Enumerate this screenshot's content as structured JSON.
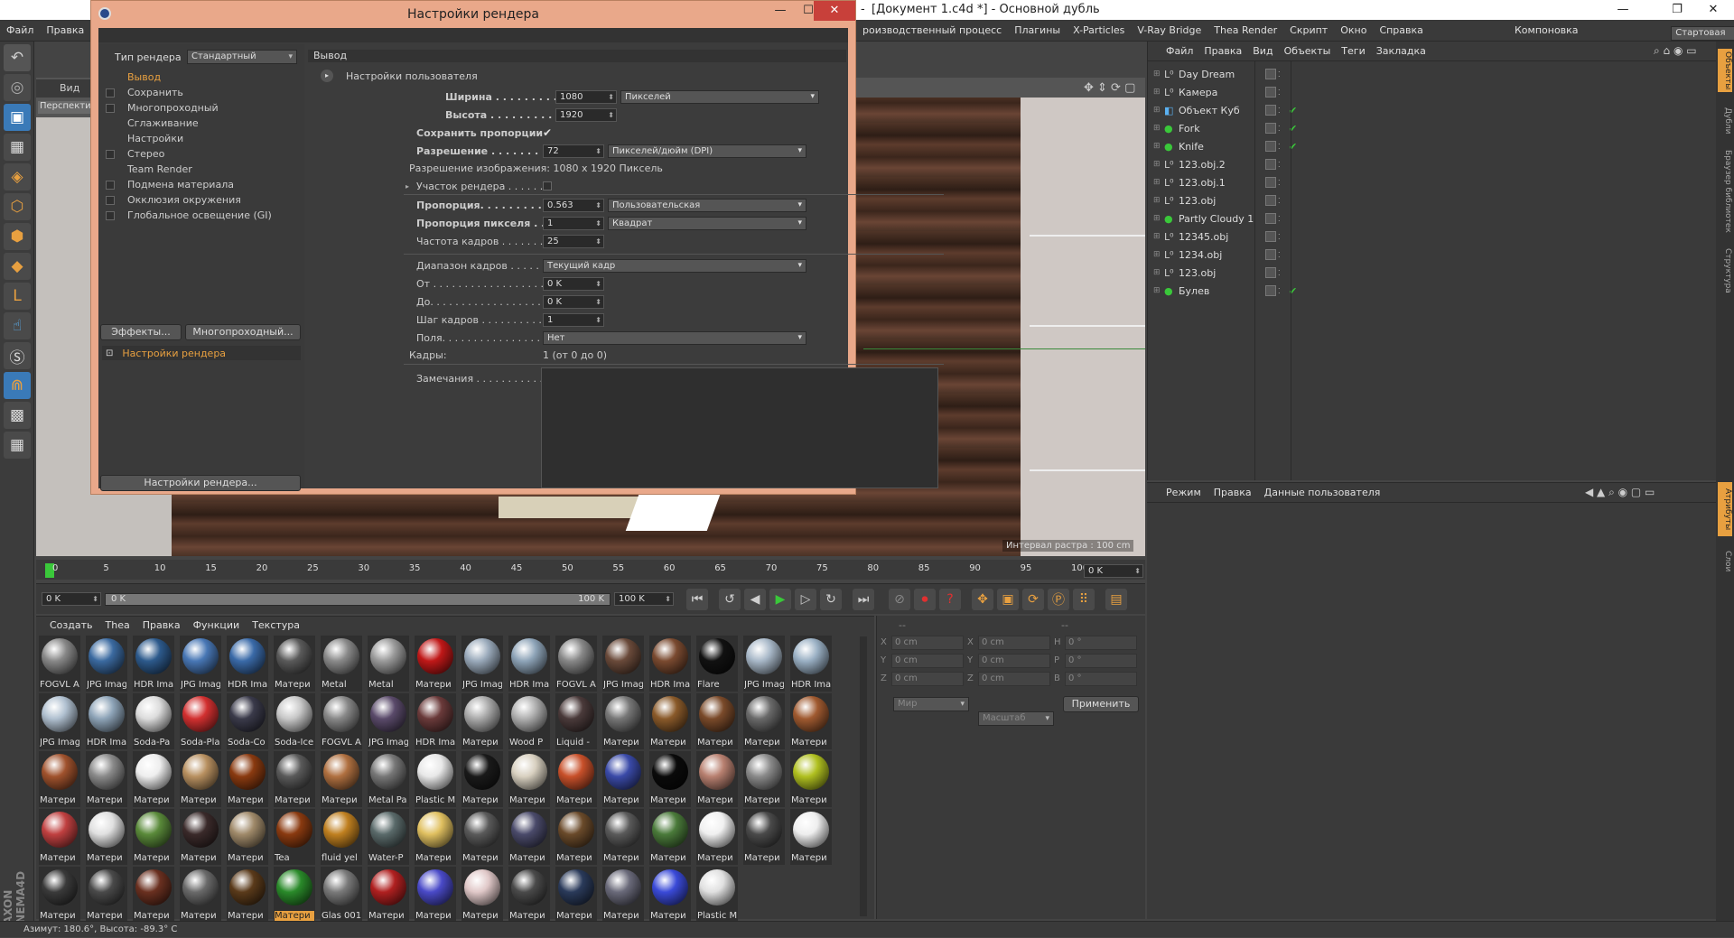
{
  "app": {
    "title": "[Документ 1.c4d *] - Основной дубль",
    "title_prefix": "-"
  },
  "menubar": {
    "items": [
      "Файл",
      "Правка"
    ],
    "right_items": [
      "роизводственный процесс",
      "Плагины",
      "X-Particles",
      "V-Ray Bridge",
      "Thea Render",
      "Скрипт",
      "Окно",
      "Справка"
    ],
    "layout_label": "Компоновка",
    "layout_value": "Стартовая"
  },
  "viewport": {
    "view_label": "Вид",
    "perspective": "Перспекти",
    "raster": "Интервал растра : 100 cm"
  },
  "timeline": {
    "ticks": [
      "0",
      "5",
      "10",
      "15",
      "20",
      "25",
      "30",
      "35",
      "40",
      "45",
      "50",
      "55",
      "60",
      "65",
      "70",
      "75",
      "80",
      "85",
      "90",
      "95",
      "100"
    ],
    "current_frame": "0 K",
    "start": "0 K",
    "range_start": "0 K",
    "range_end": "100 K",
    "end": "100 K"
  },
  "materials": {
    "menu": [
      "Создать",
      "Thea",
      "Правка",
      "Функции",
      "Текстура"
    ],
    "items": [
      {
        "label": "FOGVL A",
        "color": "#888"
      },
      {
        "label": "JPG Imag",
        "color": "#3b6aa0"
      },
      {
        "label": "HDR Ima",
        "color": "#2d5a8c"
      },
      {
        "label": "JPG Imag",
        "color": "#4877b5"
      },
      {
        "label": "HDR Ima",
        "color": "#3a6aa8"
      },
      {
        "label": "Матери",
        "color": "#5a5a5a"
      },
      {
        "label": "Metal",
        "color": "#8a8a8a"
      },
      {
        "label": "Metal",
        "color": "#9a9a9a"
      },
      {
        "label": "Матери",
        "color": "#c01818"
      },
      {
        "label": "JPG Imag",
        "color": "#9aaabb"
      },
      {
        "label": "HDR Ima",
        "color": "#8ea4b8"
      },
      {
        "label": "FOGVL A",
        "color": "#888"
      },
      {
        "label": "JPG Imag",
        "color": "#6a4a3a"
      },
      {
        "label": "HDR Ima",
        "color": "#7a4a30"
      },
      {
        "label": "Flare",
        "color": "#111"
      },
      {
        "label": "JPG Imag",
        "color": "#a8b8c8"
      },
      {
        "label": "HDR Ima",
        "color": "#9ab0c4"
      },
      {
        "label": "JPG Imag",
        "color": "#b0c0d0"
      },
      {
        "label": "HDR Ima",
        "color": "#8ea4b8"
      },
      {
        "label": "Soda-Pa",
        "color": "#dcdcdc"
      },
      {
        "label": "Soda-Pla",
        "color": "#d23030"
      },
      {
        "label": "Soda-Co",
        "color": "#3a3a4a"
      },
      {
        "label": "Soda-Ice",
        "color": "#c8c8c8"
      },
      {
        "label": "FOGVL A",
        "color": "#888"
      },
      {
        "label": "JPG Imag",
        "color": "#5a4a6a"
      },
      {
        "label": "HDR Ima",
        "color": "#6a3a3a"
      },
      {
        "label": "Матери",
        "color": "#aaaaaa"
      },
      {
        "label": "Wood P",
        "color": "#b0b0b0"
      },
      {
        "label": "Liquid -",
        "color": "#4a3a3a"
      },
      {
        "label": "Матери",
        "color": "#777777"
      },
      {
        "label": "Матери",
        "color": "#8a5a2a"
      },
      {
        "label": "Матери",
        "color": "#7a4a2a"
      },
      {
        "label": "Матери",
        "color": "#6a6a6a"
      },
      {
        "label": "Матери",
        "color": "#a05a30"
      },
      {
        "label": "Матери",
        "color": "#a0522d"
      },
      {
        "label": "Матери",
        "color": "#8a8a8a"
      },
      {
        "label": "Матери",
        "color": "#eeeeee"
      },
      {
        "label": "Матери",
        "color": "#b89060"
      },
      {
        "label": "Матери",
        "color": "#8a3a10"
      },
      {
        "label": "Матери",
        "color": "#5a5a5a"
      },
      {
        "label": "Матери",
        "color": "#b07040"
      },
      {
        "label": "Metal Pa",
        "color": "#777777"
      },
      {
        "label": "Plastic M",
        "color": "#e8e8e8"
      },
      {
        "label": "Матери",
        "color": "#1a1a1a"
      },
      {
        "label": "Матери",
        "color": "#d8d0c0"
      },
      {
        "label": "Матери",
        "color": "#c8502a"
      },
      {
        "label": "Матери",
        "color": "#3a4aa8"
      },
      {
        "label": "Матери",
        "color": "#0a0a0a"
      },
      {
        "label": "Матери",
        "color": "#b88070"
      },
      {
        "label": "Матери",
        "color": "#8a8a8a"
      },
      {
        "label": "Матери",
        "color": "#b0c020"
      },
      {
        "label": "Матери",
        "color": "#c04040"
      },
      {
        "label": "Матери",
        "color": "#e0e0e0"
      },
      {
        "label": "Матери",
        "color": "#5a8a3a"
      },
      {
        "label": "Матери",
        "color": "#3a2a2a"
      },
      {
        "label": "Матери",
        "color": "#a08a6a"
      },
      {
        "label": "Tea",
        "color": "#8a3a10"
      },
      {
        "label": "fluid yel",
        "color": "#c08020"
      },
      {
        "label": "Water-P",
        "color": "#5a6a6a"
      },
      {
        "label": "Матери",
        "color": "#e0c060"
      },
      {
        "label": "Матери",
        "color": "#5a5a5a"
      },
      {
        "label": "Матери",
        "color": "#4a4a6a"
      },
      {
        "label": "Матери",
        "color": "#6a4a2a"
      },
      {
        "label": "Матери",
        "color": "#5a5a5a"
      },
      {
        "label": "Матери",
        "color": "#4a7a3a"
      },
      {
        "label": "Матери",
        "color": "#f0f0f0"
      },
      {
        "label": "Матери",
        "color": "#4a4a4a"
      },
      {
        "label": "Матери",
        "color": "#eeeeee"
      },
      {
        "label": "Матери",
        "color": "#3a3a3a"
      },
      {
        "label": "Матери",
        "color": "#4a4a4a"
      },
      {
        "label": "Матери",
        "color": "#6a3020"
      },
      {
        "label": "Матери",
        "color": "#6a6a6a"
      },
      {
        "label": "Матери",
        "color": "#5a3a1a"
      },
      {
        "label": "Матери",
        "color": "#2a8a2a"
      },
      {
        "label": "Glas 001",
        "color": "#7a7a7a"
      },
      {
        "label": "Матери",
        "color": "#b02020"
      },
      {
        "label": "Матери",
        "color": "#4a4ac8"
      },
      {
        "label": "Матери",
        "color": "#e0c8c8"
      },
      {
        "label": "Матери",
        "color": "#4a4a4a"
      },
      {
        "label": "Матери",
        "color": "#2a3a5a"
      },
      {
        "label": "Матери",
        "color": "#6a6a7a"
      },
      {
        "label": "Матери",
        "color": "#3a4ad8"
      },
      {
        "label": "Plastic M",
        "color": "#e0e0e0"
      }
    ],
    "selected_index": 73
  },
  "coords": {
    "rows": [
      {
        "a": "X",
        "av": "0 cm",
        "b": "X",
        "bv": "0 cm",
        "c": "H",
        "cv": "0 °"
      },
      {
        "a": "Y",
        "av": "0 cm",
        "b": "Y",
        "bv": "0 cm",
        "c": "P",
        "cv": "0 °"
      },
      {
        "a": "Z",
        "av": "0 cm",
        "b": "Z",
        "bv": "0 cm",
        "c": "B",
        "cv": "0 °"
      }
    ],
    "space": "Мир",
    "scale": "Масштаб",
    "apply": "Применить",
    "dash1": "--",
    "dash2": "--"
  },
  "objects": {
    "menu": [
      "Файл",
      "Правка",
      "Вид",
      "Объекты",
      "Теги",
      "Закладка"
    ],
    "items": [
      {
        "name": "Day Dream",
        "check": false
      },
      {
        "name": "Камера",
        "check": false
      },
      {
        "name": "Объект Куб",
        "check": true
      },
      {
        "name": "Fork",
        "check": true
      },
      {
        "name": "Knife",
        "check": true
      },
      {
        "name": "123.obj.2",
        "check": false
      },
      {
        "name": "123.obj.1",
        "check": false
      },
      {
        "name": "123.obj",
        "check": false
      },
      {
        "name": "Partly Cloudy 1",
        "check": false
      },
      {
        "name": "12345.obj",
        "check": false
      },
      {
        "name": "1234.obj",
        "check": false
      },
      {
        "name": "123.obj",
        "check": false
      },
      {
        "name": "Булев",
        "check": true
      }
    ]
  },
  "attributes": {
    "menu": [
      "Режим",
      "Правка",
      "Данные пользователя"
    ]
  },
  "right_tabs": [
    "Объекты",
    "Дубли",
    "Браузер библиотек",
    "Структура",
    "Атрибуты",
    "Слои"
  ],
  "status": "Азимут: 180.6°, Высота: -89.3°  C",
  "dialog": {
    "title": "Настройки рендера",
    "renderer_label": "Тип рендера",
    "renderer_value": "Стандартный",
    "left_items": [
      {
        "label": "Вывод",
        "checkbox": false,
        "active": true
      },
      {
        "label": "Сохранить",
        "checkbox": true
      },
      {
        "label": "Многопроходный",
        "checkbox": true
      },
      {
        "label": "Сглаживание",
        "checkbox": false
      },
      {
        "label": "Настройки",
        "checkbox": false
      },
      {
        "label": "Стерео",
        "checkbox": true
      },
      {
        "label": "Team Render",
        "checkbox": false
      },
      {
        "label": "Подмена материала",
        "checkbox": true
      },
      {
        "label": "Окклюзия окружения",
        "checkbox": true
      },
      {
        "label": "Глобальное освещение (GI)",
        "checkbox": true
      }
    ],
    "effects_btn": "Эффекты...",
    "multipass_btn": "Многопроходный...",
    "preset": "Настройки рендера",
    "bottom_btn": "Настройки рендера...",
    "section": "Вывод",
    "user_settings": "Настройки пользователя",
    "width_label": "Ширина . . . . . . . . . . . . . .",
    "width": "1080",
    "unit": "Пикселей",
    "height_label": "Высота . . . . . . . . . . . . . . .",
    "height": "1920",
    "keep_ratio": "Сохранить пропорции",
    "resolution_label": "Разрешение . . . . . . . . . .",
    "resolution": "72",
    "res_unit": "Пикселей/дюйм (DPI)",
    "image_res": "Разрешение изображения: 1080 x 1920 Пиксель",
    "region": "Участок рендера . . . . . .",
    "aspect_label": "Пропорция. . . . . . . . . . . .",
    "aspect": "0.563",
    "aspect_mode": "Пользовательская",
    "pixel_label": "Пропорция пикселя . . . .",
    "pixel": "1",
    "pixel_mode": "Квадрат",
    "fps_label": "Частота кадров . . . . . . .",
    "fps": "25",
    "range_label": "Диапазон кадров . . . . . . . .",
    "range": "Текущий кадр",
    "from_label": "От . . . . . . . . . . . . . . . . . .",
    "from": "0 K",
    "to_label": "До. . . . . . . . . . . . . . . . . .",
    "to": "0 K",
    "step_label": "Шаг кадров . . . . . . . . . . .",
    "step": "1",
    "fields_label": "Поля. . . . . . . . . . . . . . . . .",
    "fields": "Нет",
    "frames_label": "Кадры:",
    "frames": "1 (от 0 до 0)",
    "notes_label": "Замечания . . . . . . . . . . . ."
  }
}
